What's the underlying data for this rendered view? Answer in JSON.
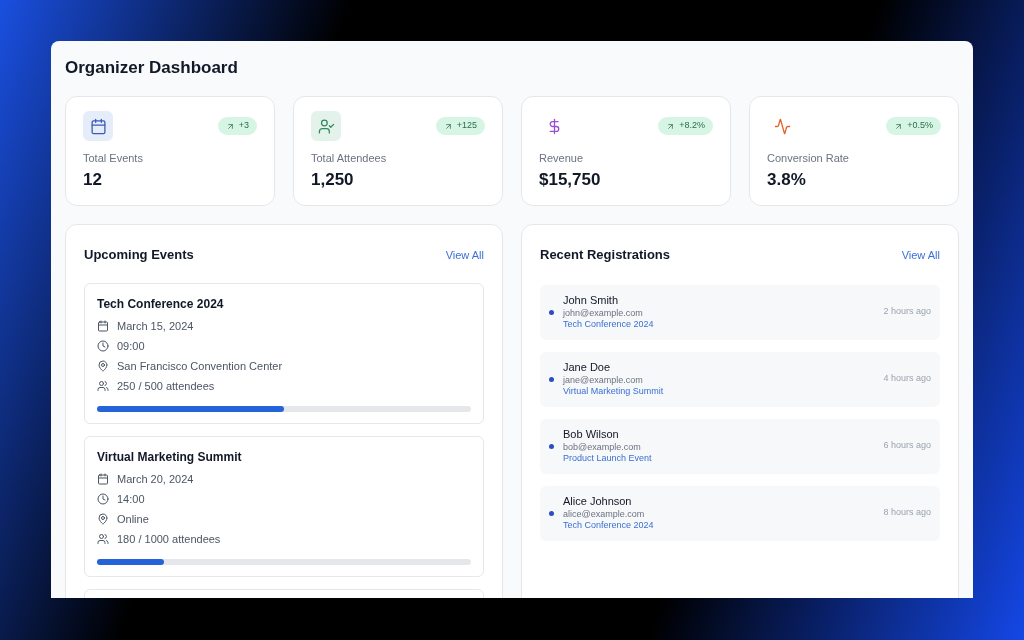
{
  "title": "Organizer Dashboard",
  "stats": [
    {
      "kind": "events",
      "label": "Total Events",
      "value": "12",
      "change": "+3"
    },
    {
      "kind": "attendees",
      "label": "Total Attendees",
      "value": "1,250",
      "change": "+125"
    },
    {
      "kind": "revenue",
      "label": "Revenue",
      "value": "$15,750",
      "change": "+8.2%"
    },
    {
      "kind": "conversion",
      "label": "Conversion Rate",
      "value": "3.8%",
      "change": "+0.5%"
    }
  ],
  "upcoming_events": {
    "title": "Upcoming Events",
    "link": "View All",
    "events": [
      {
        "name": "Tech Conference 2024",
        "date": "March 15, 2024",
        "time": "09:00",
        "location": "San Francisco Convention Center",
        "attendance": "250 / 500 attendees",
        "level": 0.5
      },
      {
        "name": "Virtual Marketing Summit",
        "date": "March 20, 2024",
        "time": "14:00",
        "location": "Online",
        "attendance": "180 / 1000 attendees",
        "level": 0.18
      }
    ]
  },
  "recent_registrations": {
    "title": "Recent Registrations",
    "link": "View All",
    "items": [
      {
        "name": "John Smith",
        "email": "john@example.com",
        "event": "Tech Conference 2024",
        "time": "2 hours ago"
      },
      {
        "name": "Jane Doe",
        "email": "jane@example.com",
        "event": "Virtual Marketing Summit",
        "time": "4 hours ago"
      },
      {
        "name": "Bob Wilson",
        "email": "bob@example.com",
        "event": "Product Launch Event",
        "time": "6 hours ago"
      },
      {
        "name": "Alice Johnson",
        "email": "alice@example.com",
        "event": "Tech Conference 2024",
        "time": "8 hours ago"
      }
    ]
  }
}
